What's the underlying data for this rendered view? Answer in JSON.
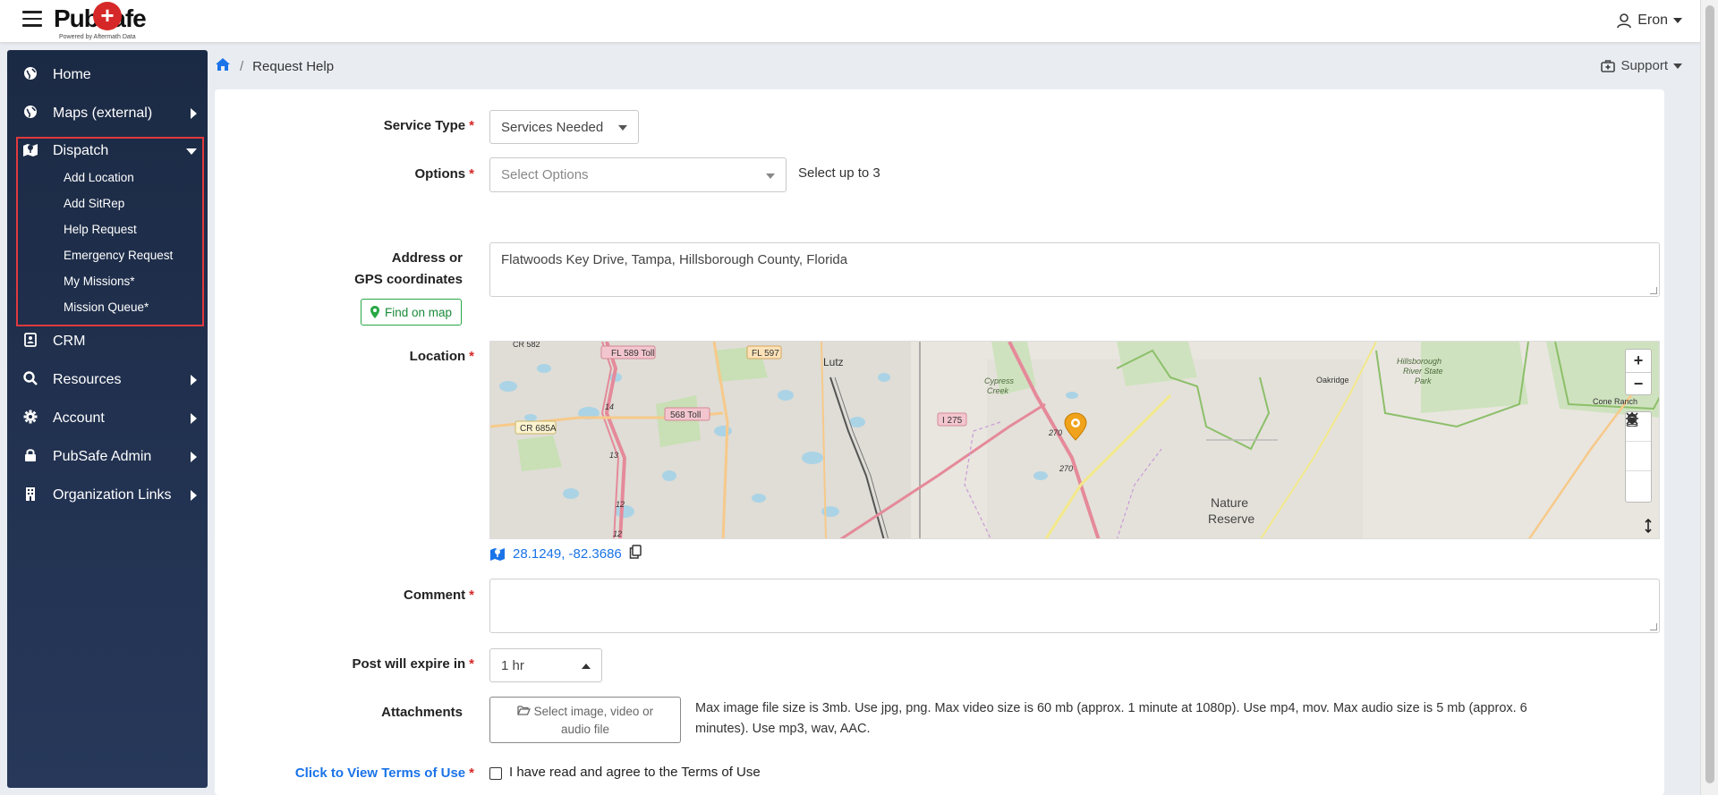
{
  "app": {
    "logo_text": "PubSafe",
    "logo_tagline": "Powered by Aftermath Data",
    "user_name": "Eron"
  },
  "breadcrumb": {
    "current": "Request Help"
  },
  "support_label": "Support",
  "sidebar": {
    "items": [
      {
        "label": "Home",
        "icon": "globe-icon"
      },
      {
        "label": "Maps (external)",
        "icon": "globe-icon"
      },
      {
        "label": "Dispatch",
        "icon": "map-marker-icon"
      },
      {
        "label": "CRM",
        "icon": "address-book-icon"
      },
      {
        "label": "Resources",
        "icon": "search-icon"
      },
      {
        "label": "Account",
        "icon": "gear-icon"
      },
      {
        "label": "PubSafe Admin",
        "icon": "lock-icon"
      },
      {
        "label": "Organization Links",
        "icon": "building-icon"
      }
    ],
    "dispatch_sub": [
      "Add Location",
      "Add SitRep",
      "Help Request",
      "Emergency Request",
      "My Missions*",
      "Mission Queue*"
    ]
  },
  "form": {
    "service_type": {
      "label": "Service Type",
      "value": "Services Needed"
    },
    "options": {
      "label": "Options",
      "placeholder": "Select Options",
      "hint": "Select up to 3"
    },
    "address": {
      "label_line1": "Address or",
      "label_line2": "GPS coordinates",
      "value": "Flatwoods Key Drive, Tampa, Hillsborough County, Florida",
      "find_button": "Find on map"
    },
    "location": {
      "label": "Location",
      "coords": "28.1249, -82.3686"
    },
    "comment": {
      "label": "Comment",
      "value": ""
    },
    "expire": {
      "label": "Post will expire in",
      "value": "1 hr"
    },
    "attachments": {
      "label": "Attachments",
      "button_line1": "Select image, video or",
      "button_line2": "audio file",
      "help_line1": "Max image file size is 3mb. Use jpg, png. Max video size is 60 mb (approx. 1 minute at 1080p). Use mp4, mov. Max audio size is 5 mb (approx. 6",
      "help_line2": "minutes). Use mp3, wav, AAC."
    },
    "terms": {
      "link": "Click to View Terms of Use",
      "checkbox_label": "I have read and agree to the Terms of Use"
    }
  },
  "map": {
    "labels": {
      "fl589": "FL 589 Toll",
      "fl597": "FL 597",
      "lutz": "Lutz",
      "cypress1": "Cypress",
      "cypress2": "Creek",
      "hills1": "Hillsborough",
      "hills2": "River State",
      "hills3": "Park",
      "oakridge": "Oakridge",
      "cone": "Cone Ranch",
      "cr685": "CR 685A",
      "t568": "568 Toll",
      "i275": "I 275",
      "r270a": "270",
      "r270b": "270",
      "r14": "14",
      "r13": "13",
      "r12": "12",
      "r12b": "12",
      "nature1": "Nature",
      "nature2": "Reserve",
      "cr582": "CR 582"
    },
    "zoom_in": "+",
    "zoom_out": "−"
  }
}
